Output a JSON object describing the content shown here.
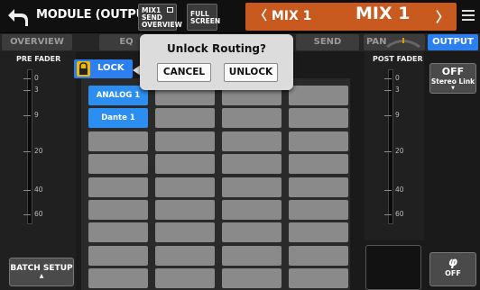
{
  "header": {
    "title": "MODULE (OUTPUT)",
    "send_overview_btn": [
      "MIX1",
      "SEND",
      "OVERVIEW"
    ],
    "full_screen_btn": [
      "FULL",
      "SCREEN"
    ],
    "mix_prev_label": "〈 MIX 1",
    "mix_name": "MIX 1",
    "mix_next_label": "〉"
  },
  "tabs": [
    {
      "label": "OVERVIEW",
      "active": false
    },
    {
      "label": "EQ",
      "active": false
    },
    {
      "label": "SEND",
      "active": false
    },
    {
      "label": "PAN",
      "active": false
    },
    {
      "label": "OUTPUT",
      "active": true
    }
  ],
  "pre_fader": {
    "label": "PRE FADER",
    "scale": [
      "0",
      "3",
      "9",
      "20",
      "40",
      "60"
    ]
  },
  "post_fader": {
    "label": "POST FADER",
    "scale": [
      "0",
      "3",
      "9",
      "20",
      "40",
      "60"
    ]
  },
  "lock_button": {
    "label": "LOCK"
  },
  "routing": {
    "assigned": [
      "ANALOG 1",
      "Dante 1"
    ],
    "rows": 9,
    "cols": 4
  },
  "stereo_link": {
    "state": "OFF",
    "label": "Stereo Link"
  },
  "batch_setup": {
    "label": "BATCH SETUP"
  },
  "phase": {
    "symbol": "φ",
    "state": "OFF"
  },
  "dialog": {
    "title": "Unlock Routing?",
    "cancel_label": "CANCEL",
    "unlock_label": "UNLOCK"
  },
  "colors": {
    "accent_blue": "#2b7ff0",
    "header_orange": "#c85a1f",
    "lock_yellow": "#f0b800"
  }
}
